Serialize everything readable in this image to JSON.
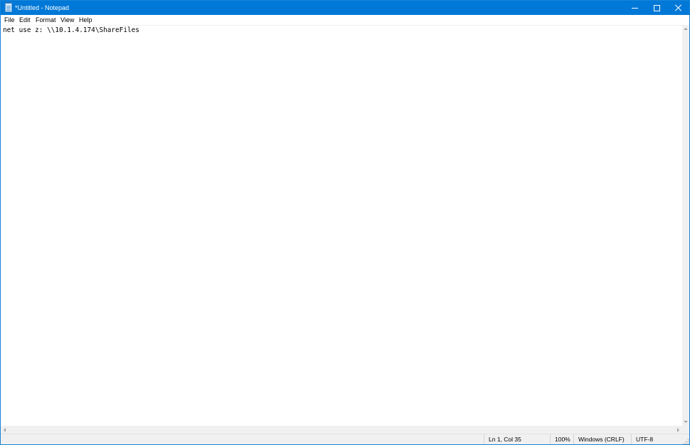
{
  "window": {
    "title": "*Untitled - Notepad",
    "accent_color": "#0078d7",
    "controls": {
      "minimize_icon": "minimize-icon",
      "maximize_icon": "maximize-icon",
      "close_icon": "close-icon"
    }
  },
  "menubar": {
    "file": "File",
    "edit": "Edit",
    "format": "Format",
    "view": "View",
    "help": "Help"
  },
  "editor": {
    "content": "net use z: \\\\10.1.4.174\\ShareFiles"
  },
  "statusbar": {
    "position": "Ln 1, Col 35",
    "zoom": "100%",
    "line_ending": "Windows (CRLF)",
    "encoding": "UTF-8"
  }
}
